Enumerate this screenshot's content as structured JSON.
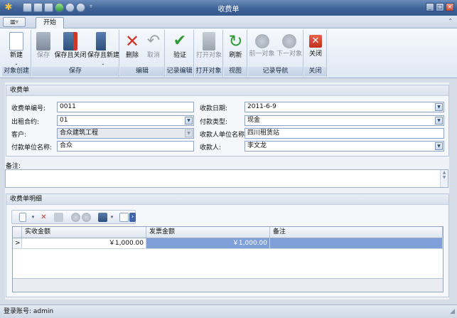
{
  "window": {
    "title": "收费单"
  },
  "ribbon": {
    "tab_active": "开始",
    "groups": [
      {
        "label": "对象创建",
        "buttons": [
          {
            "label": "新建",
            "disabled": false
          }
        ]
      },
      {
        "label": "保存",
        "buttons": [
          {
            "label": "保存",
            "disabled": true
          },
          {
            "label": "保存且关闭",
            "disabled": false
          },
          {
            "label": "保存且新建",
            "disabled": false
          }
        ]
      },
      {
        "label": "编辑",
        "buttons": [
          {
            "label": "删除",
            "disabled": false
          },
          {
            "label": "取消",
            "disabled": true
          }
        ]
      },
      {
        "label": "记录编辑",
        "buttons": [
          {
            "label": "验证",
            "disabled": false
          }
        ]
      },
      {
        "label": "打开对象",
        "buttons": [
          {
            "label": "打开对象",
            "disabled": true
          }
        ]
      },
      {
        "label": "视图",
        "buttons": [
          {
            "label": "刷新",
            "disabled": false
          }
        ]
      },
      {
        "label": "记录导航",
        "buttons": [
          {
            "label": "前一对象",
            "disabled": true
          },
          {
            "label": "下一对象",
            "disabled": true
          }
        ]
      },
      {
        "label": "关闭",
        "buttons": [
          {
            "label": "关闭",
            "disabled": false
          }
        ]
      }
    ]
  },
  "form": {
    "section_title": "收费单",
    "fields": {
      "receipt_no": {
        "label": "收费单编号:",
        "value": "0011"
      },
      "receipt_date": {
        "label": "收款日期:",
        "value": "2011-6-9"
      },
      "lease_contract": {
        "label": "出租合约:",
        "value": "01"
      },
      "payment_type": {
        "label": "付款类型:",
        "value": "现金"
      },
      "customer": {
        "label": "客户:",
        "value": "合众建筑工程"
      },
      "payee_unit": {
        "label": "收款人单位名称:",
        "value": "四川租赁站"
      },
      "payer_unit": {
        "label": "付款单位名称:",
        "value": "合众"
      },
      "payee": {
        "label": "收款人:",
        "value": "李文龙"
      }
    },
    "remarks_label": "备注:",
    "remarks_value": ""
  },
  "details": {
    "section_title": "收费单明细",
    "columns": [
      "实收金额",
      "发票金额",
      "备注"
    ],
    "rows": [
      {
        "marker": ">",
        "actual": "￥1,000.00",
        "invoice": "￥1,000.00",
        "remark": ""
      }
    ]
  },
  "status": {
    "text": "登录账号: admin"
  },
  "colors": {
    "titlebar": "#3e6296",
    "selected_row": "#7f9fd8",
    "delete_red": "#d0352b",
    "verify_green": "#2e9a3a"
  }
}
